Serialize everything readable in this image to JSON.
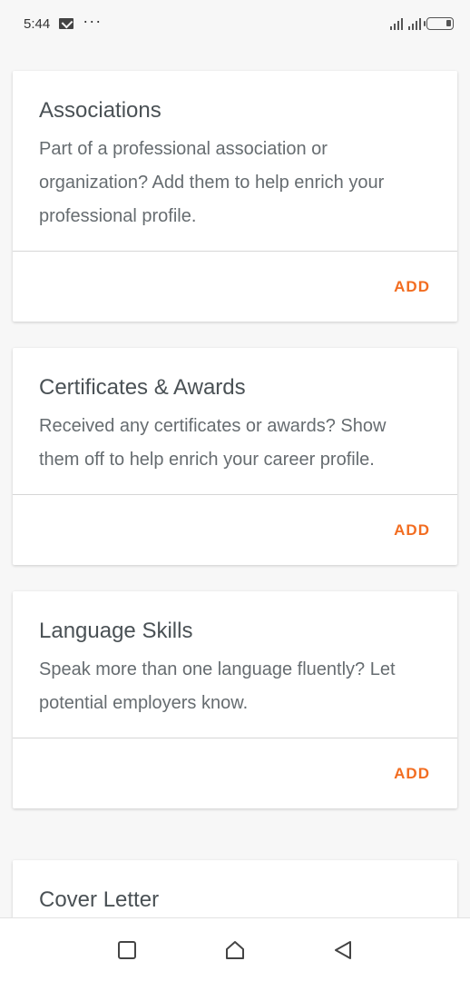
{
  "status_bar": {
    "time": "5:44",
    "more": "···"
  },
  "cards": [
    {
      "title": "Associations",
      "description": "Part of a professional association or organization? Add them to help enrich your professional profile.",
      "action": "ADD"
    },
    {
      "title": "Certificates & Awards",
      "description": "Received any certificates or awards? Show them off to help enrich your career profile.",
      "action": "ADD"
    },
    {
      "title": "Language Skills",
      "description": "Speak more than one language fluently? Let potential employers know.",
      "action": "ADD"
    },
    {
      "title": "Cover Letter"
    }
  ],
  "colors": {
    "accent": "#f26d21",
    "title": "#4a5155",
    "body": "#666c70"
  },
  "nav_icons": [
    "recent-apps-icon",
    "home-icon",
    "back-icon"
  ]
}
